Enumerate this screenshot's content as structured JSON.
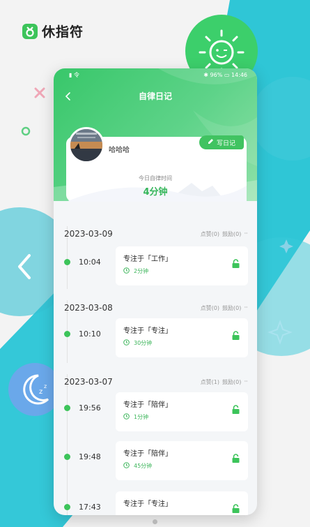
{
  "app": {
    "name": "休指符"
  },
  "phone": {
    "status": {
      "left": "▮ 令",
      "right": "✱ 96% ▭ 14:46"
    },
    "title": "自律日记",
    "profile": {
      "username": "哈哈哈",
      "write_label": "写日记"
    },
    "today": {
      "label": "今日自律时间",
      "value": "4分钟"
    },
    "groups": [
      {
        "date": "2023-03-09",
        "likes": "点赞(0)",
        "cheers": "鼓励(0)",
        "more": "···",
        "entries": [
          {
            "time": "10:04",
            "title": "专注于「工作」",
            "duration": "2分钟"
          }
        ]
      },
      {
        "date": "2023-03-08",
        "likes": "点赞(0)",
        "cheers": "鼓励(0)",
        "more": "···",
        "entries": [
          {
            "time": "10:10",
            "title": "专注于「专注」",
            "duration": "30分钟"
          }
        ]
      },
      {
        "date": "2023-03-07",
        "likes": "点赞(1)",
        "cheers": "鼓励(0)",
        "more": "···",
        "entries": [
          {
            "time": "19:56",
            "title": "专注于「陪伴」",
            "duration": "1分钟"
          },
          {
            "time": "19:48",
            "title": "专注于「陪伴」",
            "duration": "45分钟"
          },
          {
            "time": "17:43",
            "title": "专注于「专注」",
            "duration": ""
          }
        ]
      }
    ]
  },
  "colors": {
    "accent": "#3cc45a",
    "background_band": "#2ec5d8"
  },
  "icons": [
    "logo-icon",
    "sun-face-icon",
    "moon-zz-icon",
    "sparkle-icon",
    "back-icon",
    "pencil-icon",
    "clock-icon",
    "lock-icon",
    "chevron-left-icon"
  ]
}
